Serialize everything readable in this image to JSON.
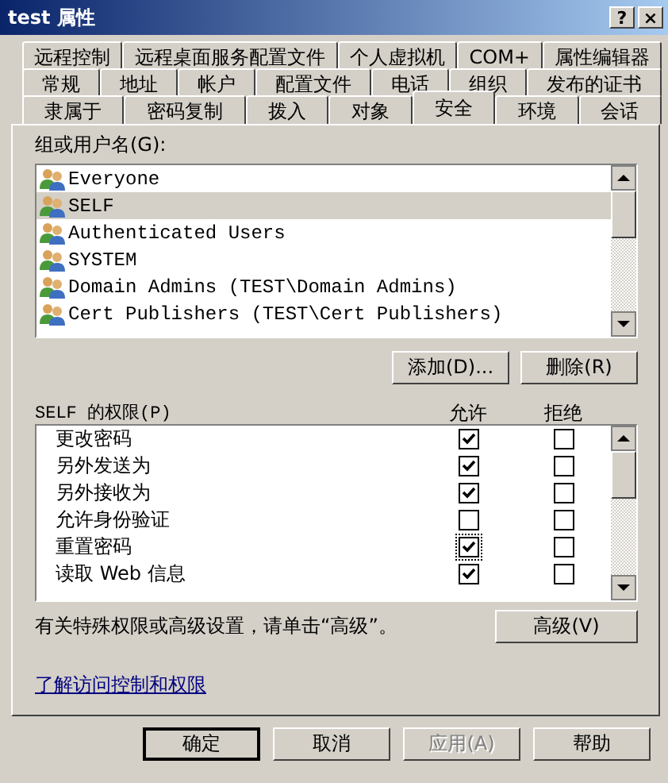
{
  "window": {
    "title": "test 属性",
    "title_buttons": [
      "?",
      "×"
    ]
  },
  "tabs": [
    [
      {
        "label": "远程控制",
        "selected": false
      },
      {
        "label": "远程桌面服务配置文件",
        "selected": false
      },
      {
        "label": "个人虚拟机",
        "selected": false
      },
      {
        "label": "COM+",
        "selected": false
      },
      {
        "label": "属性编辑器",
        "selected": false
      }
    ],
    [
      {
        "label": "常规",
        "selected": false
      },
      {
        "label": "地址",
        "selected": false
      },
      {
        "label": "帐户",
        "selected": false
      },
      {
        "label": "配置文件",
        "selected": false
      },
      {
        "label": "电话",
        "selected": false
      },
      {
        "label": "组织",
        "selected": false
      },
      {
        "label": "发布的证书",
        "selected": false
      }
    ],
    [
      {
        "label": "隶属于",
        "selected": false
      },
      {
        "label": "密码复制",
        "selected": false
      },
      {
        "label": "拨入",
        "selected": false
      },
      {
        "label": "对象",
        "selected": false
      },
      {
        "label": "安全",
        "selected": true
      },
      {
        "label": "环境",
        "selected": false
      },
      {
        "label": "会话",
        "selected": false
      }
    ]
  ],
  "users": {
    "label": "组或用户名(G):",
    "items": [
      {
        "name": "Everyone",
        "selected": false
      },
      {
        "name": "SELF",
        "selected": true
      },
      {
        "name": "Authenticated Users",
        "selected": false
      },
      {
        "name": "SYSTEM",
        "selected": false
      },
      {
        "name": "Domain Admins (TEST\\Domain Admins)",
        "selected": false
      },
      {
        "name": "Cert Publishers (TEST\\Cert Publishers)",
        "selected": false
      }
    ],
    "buttons": [
      "添加(D)...",
      "删除(R)"
    ]
  },
  "permissions": {
    "label": "SELF 的权限(P)",
    "columns": [
      "允许",
      "拒绝"
    ],
    "rows": [
      {
        "name": "更改密码",
        "allow": true,
        "deny": false,
        "focused": false
      },
      {
        "name": "另外发送为",
        "allow": true,
        "deny": false,
        "focused": false
      },
      {
        "name": "另外接收为",
        "allow": true,
        "deny": false,
        "focused": false
      },
      {
        "name": "允许身份验证",
        "allow": false,
        "deny": false,
        "focused": false
      },
      {
        "name": "重置密码",
        "allow": true,
        "deny": false,
        "focused": true
      },
      {
        "name": "读取 Web 信息",
        "allow": true,
        "deny": false,
        "focused": false
      }
    ]
  },
  "advanced": {
    "text": "有关特殊权限或高级设置，请单击“高级”。",
    "button": "高级(V)"
  },
  "link": "了解访问控制和权限",
  "footer_buttons": [
    {
      "label": "确定",
      "disabled": false,
      "default": true
    },
    {
      "label": "取消",
      "disabled": false,
      "default": false
    },
    {
      "label": "应用(A)",
      "disabled": true,
      "default": false
    },
    {
      "label": "帮助",
      "disabled": false,
      "default": false
    }
  ]
}
